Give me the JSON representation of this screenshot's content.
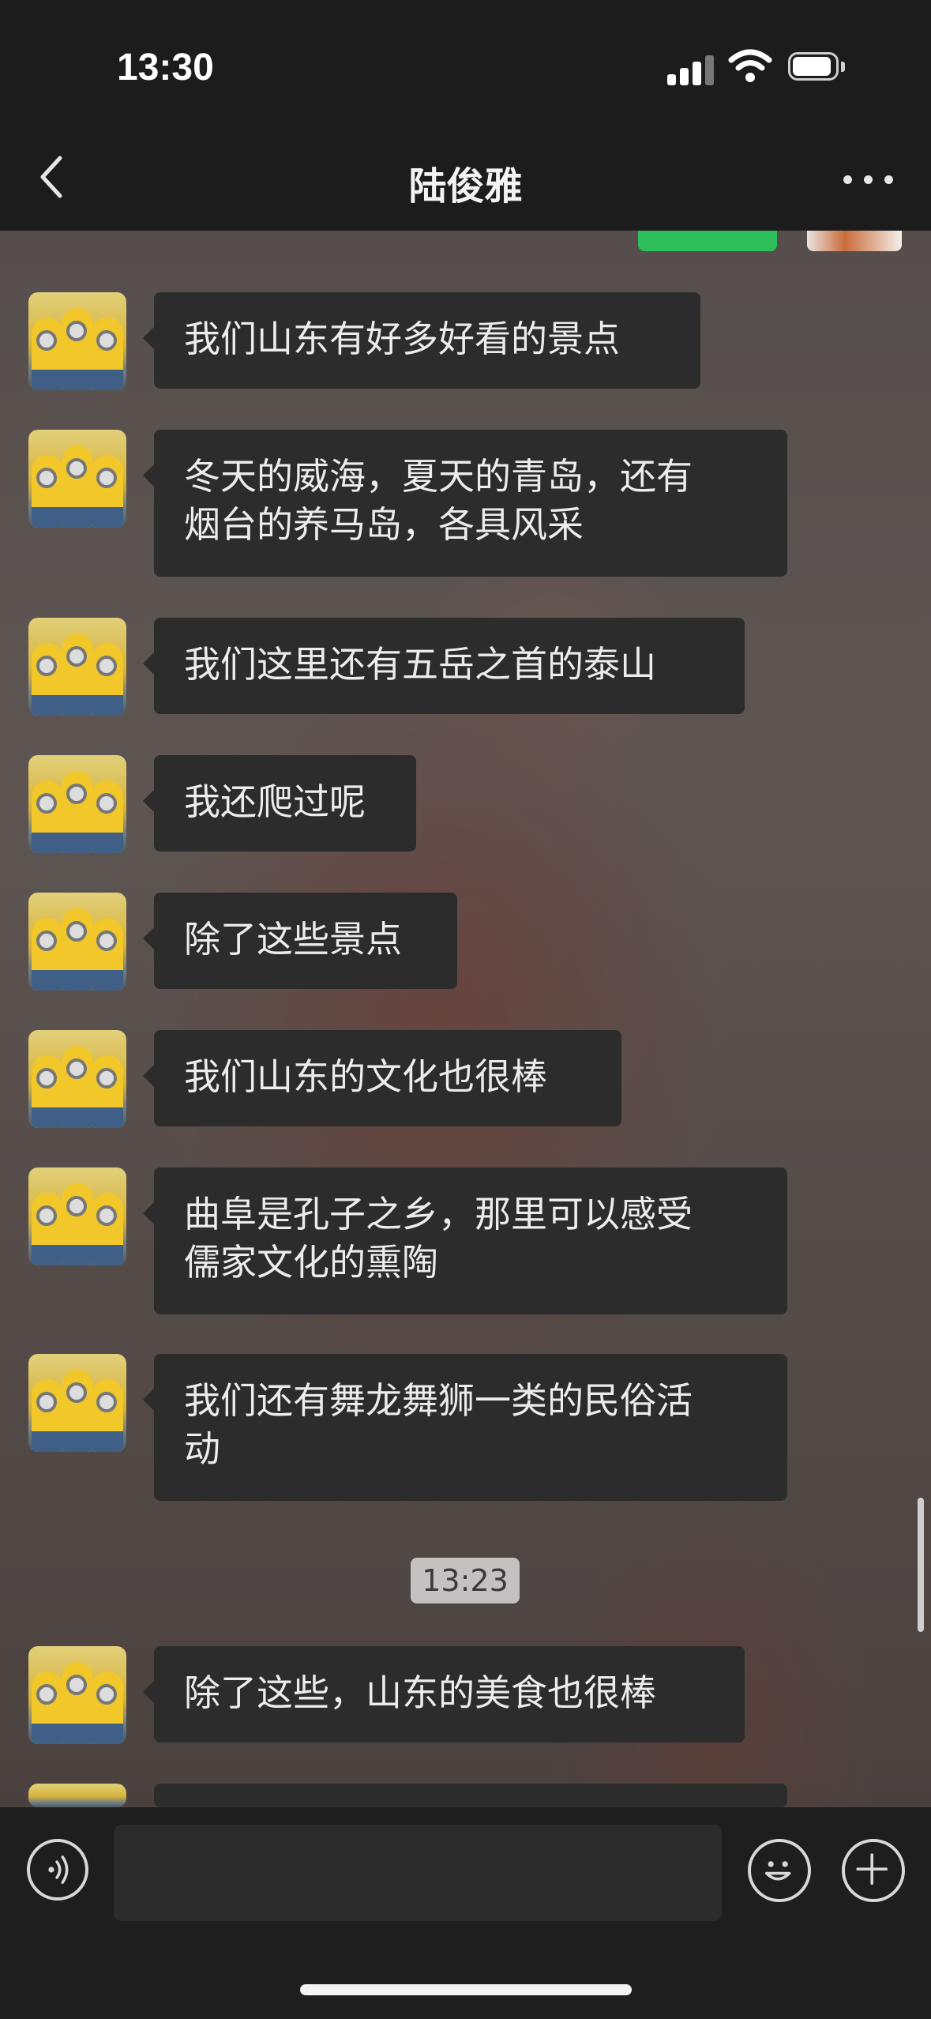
{
  "status_bar": {
    "time": "13:30"
  },
  "nav": {
    "title": "陆俊雅"
  },
  "messages": [
    {
      "text": "我们山东有好多好看的景点"
    },
    {
      "text": "冬天的威海，夏天的青岛，还有\n烟台的养马岛，各具风采"
    },
    {
      "text": "我们这里还有五岳之首的泰山"
    },
    {
      "text": "我还爬过呢"
    },
    {
      "text": "除了这些景点"
    },
    {
      "text": "我们山东的文化也很棒"
    },
    {
      "text": "曲阜是孔子之乡，那里可以感受\n儒家文化的熏陶"
    },
    {
      "text": "我们还有舞龙舞狮一类的民俗活\n动"
    },
    {
      "text": "除了这些，山东的美食也很棒"
    }
  ],
  "timestamp": "13:23",
  "input": {
    "value": ""
  },
  "colors": {
    "bubble": "#2c2c2c",
    "accent_green": "#2cbf5a",
    "bar": "#1c1c1c"
  },
  "icons": [
    "back-icon",
    "more-icon",
    "voice-icon",
    "emoji-icon",
    "plus-icon"
  ]
}
